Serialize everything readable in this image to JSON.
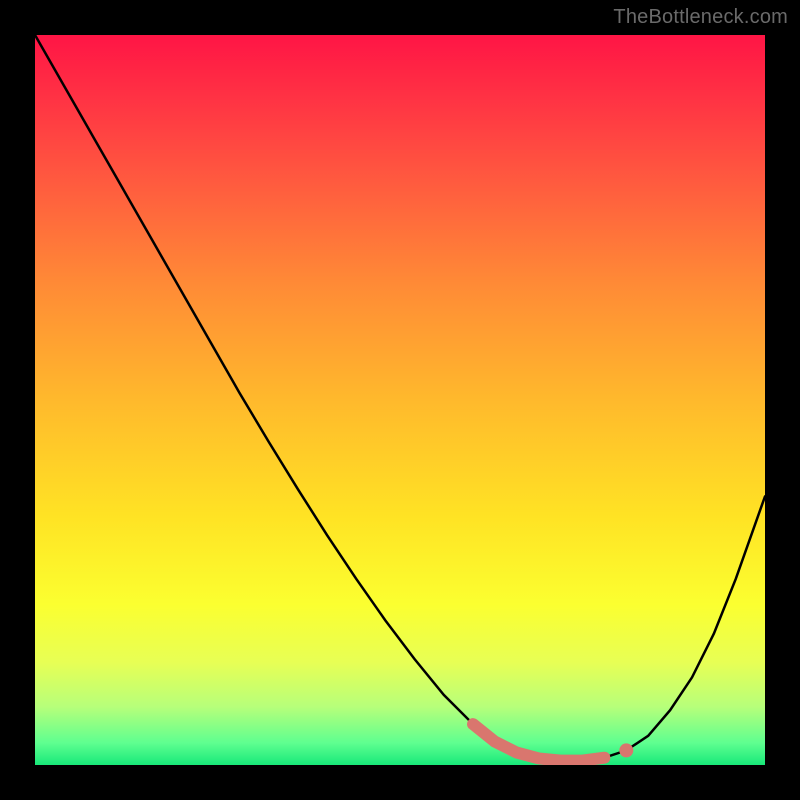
{
  "watermark": "TheBottleneck.com",
  "chart_data": {
    "type": "line",
    "title": "",
    "xlabel": "",
    "ylabel": "",
    "xlim": [
      0,
      100
    ],
    "ylim": [
      0,
      100
    ],
    "grid": false,
    "legend": false,
    "background": {
      "gradient_axis": "y",
      "stops": [
        {
          "pos": 0,
          "color": "#18e879"
        },
        {
          "pos": 3,
          "color": "#5eff90"
        },
        {
          "pos": 8,
          "color": "#b7ff7a"
        },
        {
          "pos": 14,
          "color": "#e7ff55"
        },
        {
          "pos": 22,
          "color": "#fbff30"
        },
        {
          "pos": 34,
          "color": "#ffe324"
        },
        {
          "pos": 50,
          "color": "#ffb92c"
        },
        {
          "pos": 66,
          "color": "#ff8a36"
        },
        {
          "pos": 80,
          "color": "#ff5a3f"
        },
        {
          "pos": 92,
          "color": "#ff3044"
        },
        {
          "pos": 100,
          "color": "#ff1545"
        }
      ]
    },
    "series": [
      {
        "name": "bottleneck-curve",
        "color": "#000000",
        "x": [
          0.0,
          4.0,
          8.0,
          12.0,
          16.0,
          20.0,
          24.0,
          28.0,
          32.0,
          36.0,
          40.0,
          44.0,
          48.0,
          52.0,
          56.0,
          60.0,
          63.0,
          66.0,
          69.0,
          72.0,
          75.0,
          78.0,
          81.0,
          84.0,
          87.0,
          90.0,
          93.0,
          96.0,
          100.0
        ],
        "y": [
          100.0,
          93.0,
          86.0,
          79.0,
          72.0,
          65.0,
          58.0,
          51.0,
          44.3,
          37.8,
          31.5,
          25.5,
          19.8,
          14.5,
          9.6,
          5.6,
          3.2,
          1.7,
          0.9,
          0.6,
          0.6,
          1.0,
          2.0,
          4.0,
          7.5,
          12.0,
          18.0,
          25.5,
          36.8
        ]
      }
    ],
    "markers": [
      {
        "name": "highlight-segment",
        "color": "#d9766e",
        "style": "thick-rounded",
        "x": [
          60.0,
          63.0,
          66.0,
          69.0,
          72.0,
          75.0,
          78.0
        ],
        "y": [
          5.6,
          3.2,
          1.7,
          0.9,
          0.6,
          0.6,
          1.0
        ]
      },
      {
        "name": "highlight-dot",
        "color": "#d9766e",
        "style": "dot",
        "x": [
          81.0
        ],
        "y": [
          2.0
        ]
      }
    ]
  }
}
